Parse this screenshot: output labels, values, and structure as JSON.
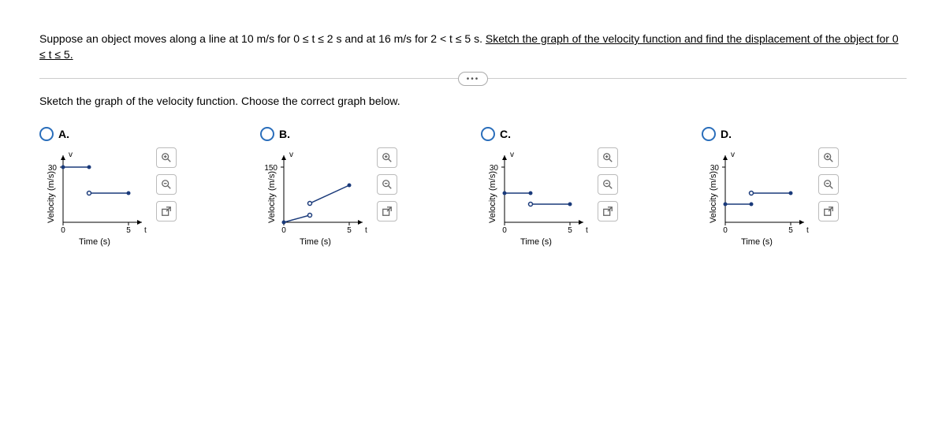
{
  "question": {
    "part1": "Suppose an object moves along a line at 10 m/s for 0 ≤ t ≤ 2 s and at 16 m/s for 2 < t ≤ 5 s. ",
    "part2_underlined": "Sketch the graph of the velocity function and find the displacement of the object for 0 ≤ t ≤ 5."
  },
  "prompt": "Sketch the graph of the velocity function. Choose the correct graph below.",
  "axes": {
    "ylabel": "Velocity (m/s)",
    "xlabel": "Time (s)",
    "x_tick_0": "0",
    "x_tick_5": "5",
    "x_var": "t",
    "y_var": "v"
  },
  "options": {
    "A": {
      "label": "A.",
      "ymax_label": "30"
    },
    "B": {
      "label": "B.",
      "ymax_label": "150"
    },
    "C": {
      "label": "C.",
      "ymax_label": "30"
    },
    "D": {
      "label": "D.",
      "ymax_label": "30"
    }
  },
  "chart_data": [
    {
      "option": "A",
      "type": "line",
      "xlabel": "Time (s)",
      "ylabel": "Velocity (m/s)",
      "xlim": [
        0,
        5
      ],
      "ylim": [
        0,
        30
      ],
      "series": [
        {
          "name": "seg1",
          "x": [
            0,
            2
          ],
          "y": [
            30,
            30
          ],
          "endpoints": [
            "closed",
            "closed"
          ]
        },
        {
          "name": "seg2",
          "x": [
            2,
            5
          ],
          "y": [
            16,
            16
          ],
          "endpoints": [
            "open",
            "closed"
          ]
        }
      ]
    },
    {
      "option": "B",
      "type": "line",
      "xlabel": "Time (s)",
      "ylabel": "Velocity (m/s)",
      "xlim": [
        0,
        5
      ],
      "ylim": [
        0,
        150
      ],
      "series": [
        {
          "name": "seg1",
          "x": [
            0,
            2
          ],
          "y": [
            0,
            20
          ],
          "endpoints": [
            "closed",
            "open"
          ]
        },
        {
          "name": "seg2",
          "x": [
            2,
            5
          ],
          "y": [
            52,
            100
          ],
          "endpoints": [
            "open",
            "closed"
          ]
        }
      ]
    },
    {
      "option": "C",
      "type": "line",
      "xlabel": "Time (s)",
      "ylabel": "Velocity (m/s)",
      "xlim": [
        0,
        5
      ],
      "ylim": [
        0,
        30
      ],
      "series": [
        {
          "name": "seg1",
          "x": [
            0,
            2
          ],
          "y": [
            16,
            16
          ],
          "endpoints": [
            "closed",
            "closed"
          ]
        },
        {
          "name": "seg2",
          "x": [
            2,
            5
          ],
          "y": [
            10,
            10
          ],
          "endpoints": [
            "open",
            "closed"
          ]
        }
      ]
    },
    {
      "option": "D",
      "type": "line",
      "xlabel": "Time (s)",
      "ylabel": "Velocity (m/s)",
      "xlim": [
        0,
        5
      ],
      "ylim": [
        0,
        30
      ],
      "series": [
        {
          "name": "seg1",
          "x": [
            0,
            2
          ],
          "y": [
            10,
            10
          ],
          "endpoints": [
            "closed",
            "closed"
          ]
        },
        {
          "name": "seg2",
          "x": [
            2,
            5
          ],
          "y": [
            16,
            16
          ],
          "endpoints": [
            "open",
            "closed"
          ]
        }
      ]
    }
  ]
}
